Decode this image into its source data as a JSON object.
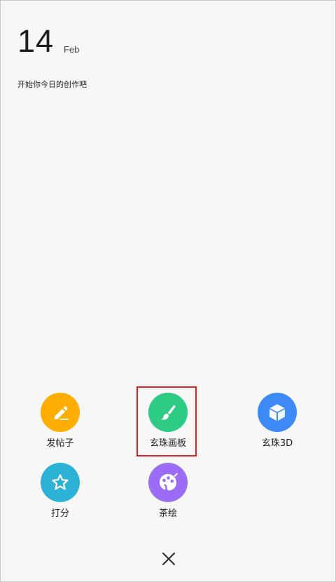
{
  "header": {
    "day": "14",
    "month": "Feb",
    "subtitle": "开始你今日的创作吧"
  },
  "actions": [
    {
      "label": "发帖子",
      "icon": "pencil-icon",
      "color": "#FFAD00"
    },
    {
      "label": "玄珠画板",
      "icon": "brush-icon",
      "color": "#2DCB83"
    },
    {
      "label": "玄珠3D",
      "icon": "cube-icon",
      "color": "#3D8AF7"
    },
    {
      "label": "打分",
      "icon": "star-icon",
      "color": "#2BB2D5"
    },
    {
      "label": "茶绘",
      "icon": "palette-icon",
      "color": "#9B6CF5"
    }
  ],
  "highlight_color": "#E02020",
  "close_icon": "close-icon"
}
